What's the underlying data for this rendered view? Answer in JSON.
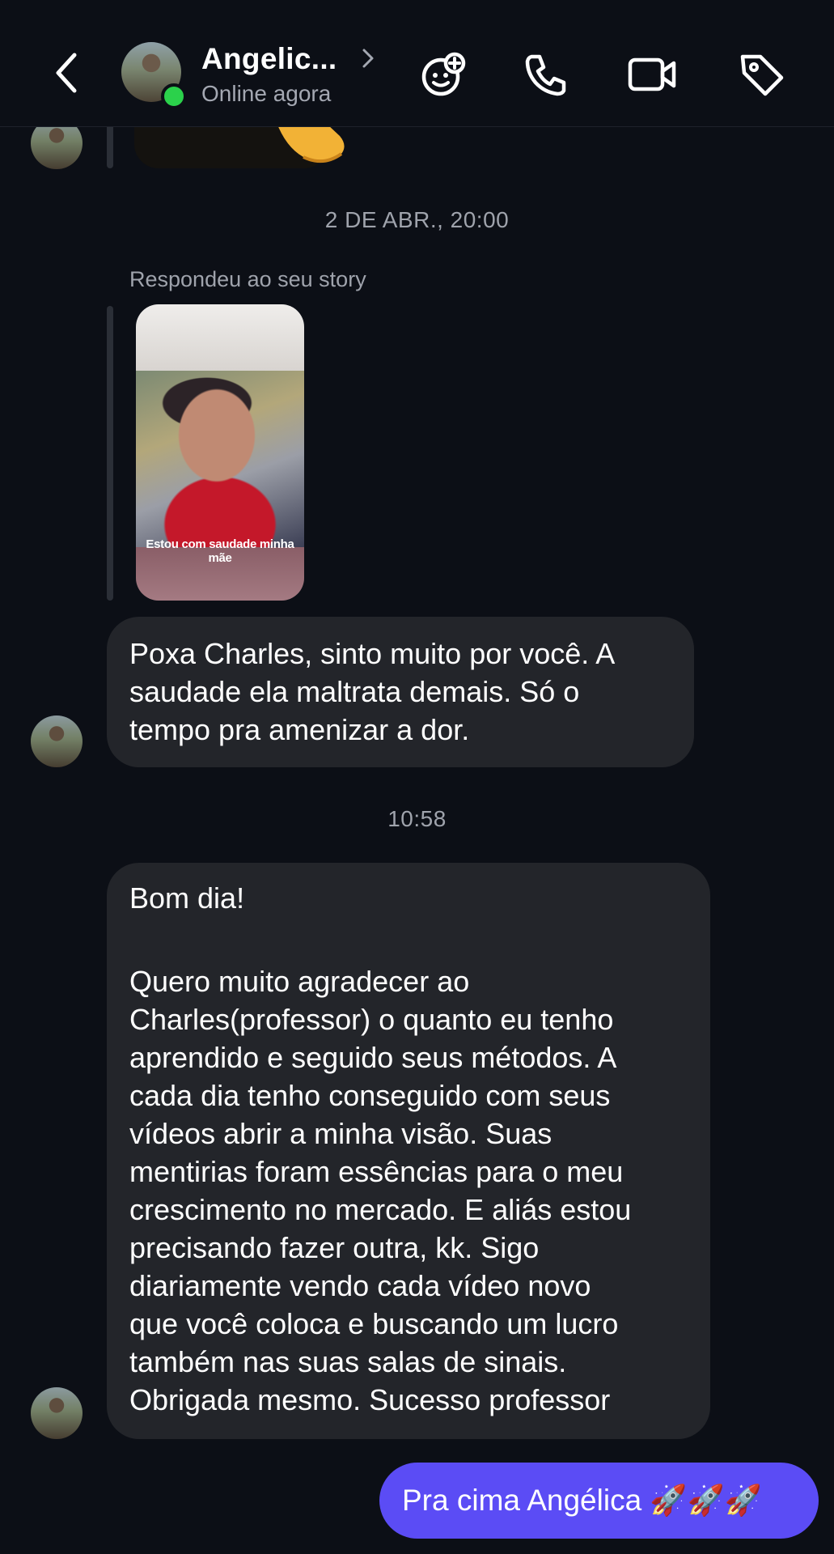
{
  "header": {
    "contact_name": "Angelic...",
    "status": "Online agora",
    "icons": [
      "back-chevron-icon",
      "effects-icon",
      "phone-icon",
      "video-icon",
      "tag-icon"
    ]
  },
  "thread": {
    "timestamp_1": "2 DE ABR., 20:00",
    "reply_label": "Respondeu ao seu story",
    "story_caption": "Estou com saudade minha mãe",
    "message_1": [
      "Poxa Charles, sinto muito por você. A",
      "saudade ela maltrata demais. Só o",
      "tempo pra amenizar a dor."
    ],
    "timestamp_2": "10:58",
    "message_2_greeting": "Bom dia!",
    "message_2_body": [
      "Quero muito agradecer ao",
      "Charles(professor) o quanto eu tenho",
      "aprendido e seguido seus métodos. A",
      "cada dia tenho conseguido com seus",
      "vídeos abrir a minha visão. Suas",
      "mentirias foram essências para o meu",
      "crescimento no mercado. E aliás estou",
      "precisando fazer outra, kk. Sigo",
      "diariamente vendo cada vídeo novo",
      "que você coloca e buscando um lucro",
      "também nas suas salas de sinais.",
      "Obrigada mesmo. Sucesso professor"
    ],
    "outgoing_message": "Pra cima Angélica 🚀🚀🚀"
  },
  "colors": {
    "background": "#0c0f16",
    "incoming_bubble": "#23252a",
    "outgoing_bubble": "#5b4cf5",
    "online": "#2bd14b",
    "muted_text": "#9fa3ac"
  }
}
